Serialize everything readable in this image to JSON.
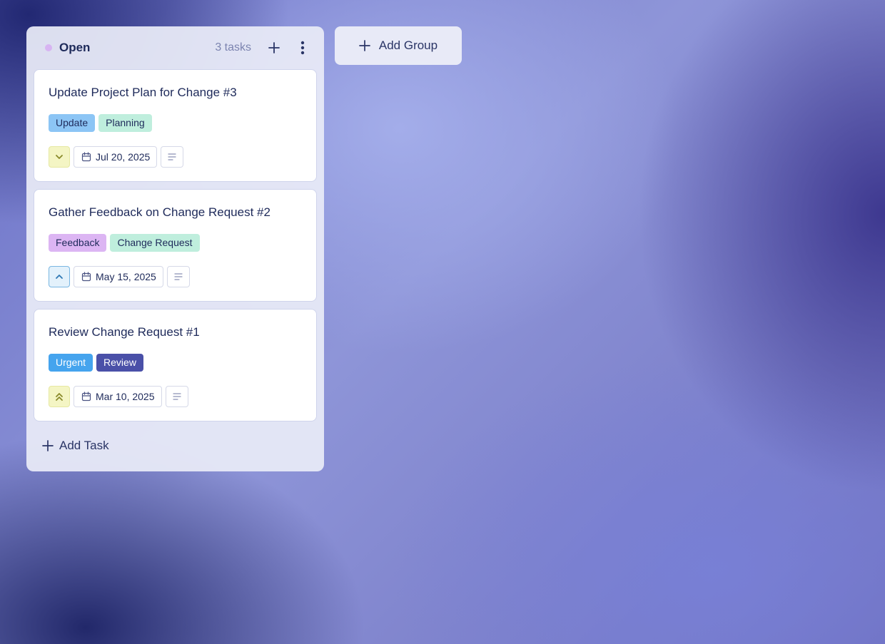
{
  "group": {
    "title": "Open",
    "task_count": "3 tasks",
    "status_color": "#d7b4f2",
    "add_icon": "plus-icon",
    "menu_icon": "vertical-dots-icon"
  },
  "tasks": [
    {
      "title": "Update Project Plan for Change #3",
      "tags": [
        {
          "label": "Update",
          "bg": "#8cc5f5",
          "fg": "#1e2a5a"
        },
        {
          "label": "Planning",
          "bg": "#bfeedd",
          "fg": "#1e2a5a"
        }
      ],
      "priority": {
        "icon": "chevron-down-icon",
        "bg": "#f4f5c4",
        "border": "#e6e8a2",
        "color": "#8a8a2a"
      },
      "date": "Jul 20, 2025"
    },
    {
      "title": "Gather Feedback on Change Request #2",
      "tags": [
        {
          "label": "Feedback",
          "bg": "#dcb5f3",
          "fg": "#1e2a5a"
        },
        {
          "label": "Change Request",
          "bg": "#bfeedd",
          "fg": "#1e2a5a"
        }
      ],
      "priority": {
        "icon": "chevron-up-icon",
        "bg": "#e3f1fb",
        "border": "#79b6e2",
        "color": "#2f78b4"
      },
      "date": "May 15, 2025"
    },
    {
      "title": "Review Change Request #1",
      "tags": [
        {
          "label": "Urgent",
          "bg": "#45a4ee",
          "fg": "#ffffff"
        },
        {
          "label": "Review",
          "bg": "#4a50a8",
          "fg": "#ffffff"
        }
      ],
      "priority": {
        "icon": "double-chevron-up-icon",
        "bg": "#f4f5c4",
        "border": "#e6e8a2",
        "color": "#8a8a2a"
      },
      "date": "Mar 10, 2025"
    }
  ],
  "add_task_label": "Add Task",
  "add_group_label": "Add Group"
}
